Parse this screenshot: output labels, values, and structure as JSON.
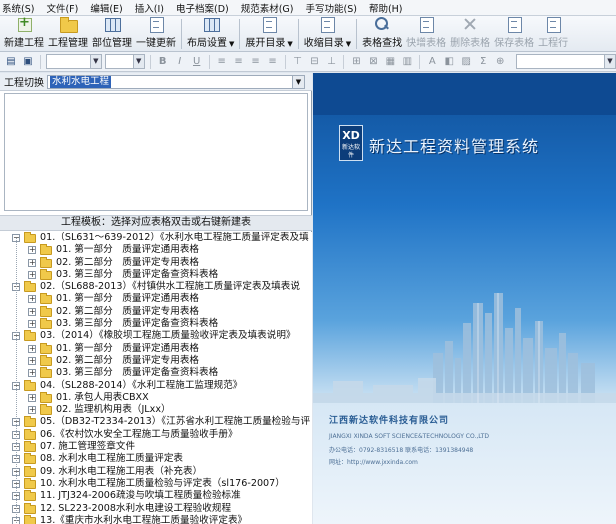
{
  "menu": [
    "系统(S)",
    "文件(F)",
    "编辑(E)",
    "插入(I)",
    "电子档案(D)",
    "规范素材(G)",
    "手写功能(S)",
    "帮助(H)"
  ],
  "toolbar": {
    "new_project": "新建工程",
    "project_manage": "工程管理",
    "dept_manage": "部位管理",
    "one_key_update": "一键更新",
    "layout_settings": "布局设置",
    "expand_dir": "展开目录",
    "collapse_dir": "收缩目录",
    "table_search": "表格查找",
    "quick_add": "快增表格",
    "delete_table": "删除表格",
    "save_table": "保存表格",
    "project_line": "工程行"
  },
  "project_switch": {
    "label": "工程切换",
    "value": "水利水电工程"
  },
  "template_header": "工程模板：选择对应表格双击或右键新建表",
  "tree": [
    {
      "level": 0,
      "text": "01.（SL631～639-2012）《水利水电工程施工质量评定表及填"
    },
    {
      "level": 1,
      "text": "01. 第一部分　质量评定通用表格"
    },
    {
      "level": 1,
      "text": "02. 第二部分　质量评定专用表格"
    },
    {
      "level": 1,
      "text": "03. 第三部分　质量评定备查资料表格"
    },
    {
      "level": 0,
      "text": "02.（SL688-2013）《村镇供水工程施工质量评定表及填表说"
    },
    {
      "level": 1,
      "text": "01. 第一部分　质量评定通用表格"
    },
    {
      "level": 1,
      "text": "02. 第二部分　质量评定专用表格"
    },
    {
      "level": 1,
      "text": "03. 第三部分　质量评定备查资料表格"
    },
    {
      "level": 0,
      "text": "03.（2014）《橡胶坝工程施工质量验收评定表及填表说明》"
    },
    {
      "level": 1,
      "text": "01. 第一部分　质量评定通用表格"
    },
    {
      "level": 1,
      "text": "02. 第二部分　质量评定专用表格"
    },
    {
      "level": 1,
      "text": "03. 第三部分　质量评定备查资料表格"
    },
    {
      "level": 0,
      "text": "04.（SL288-2014）《水利工程施工监理规范》"
    },
    {
      "level": 1,
      "text": "01. 承包人用表CBXX"
    },
    {
      "level": 1,
      "text": "02. 监理机构用表（JLxx）"
    },
    {
      "level": 0,
      "text": "05.（DB32-T2334-2013）《江苏省水利工程施工质量检验与评"
    },
    {
      "level": 0,
      "text": "06.《农村饮水安全工程施工与质量验收手册》"
    },
    {
      "level": 0,
      "text": "07. 施工管理签章文件"
    },
    {
      "level": 0,
      "text": "08. 水利水电工程施工质量评定表"
    },
    {
      "level": 0,
      "text": "09. 水利水电工程施工用表（补充表）"
    },
    {
      "level": 0,
      "text": "10. 水利水电工程施工质量检验与评定表（sl176-2007）"
    },
    {
      "level": 0,
      "text": "11. JTJ324-2006疏浚与吹填工程质量检验标准"
    },
    {
      "level": 0,
      "text": "12. SL223-2008水利水电建设工程验收规程"
    },
    {
      "level": 0,
      "text": "13.《重庆市水利水电工程施工质量验收评定表》"
    },
    {
      "level": 0,
      "text": "14.（DG-TJ08-90-2014）《上海市水利工程施工质量检验与评"
    }
  ],
  "splash": {
    "logo_text": "XD",
    "logo_sub": "新达软件",
    "title": "新达工程资料管理系统",
    "company": "江西新达软件科技有限公司",
    "line1": "JIANGXI XINDA SOFT SCIENCE&TECHNOLOGY CO.,LTD",
    "line2": "办公电话：0792-8316518  联系电话：1391384948",
    "line3": "网址：http://www.jxxinda.com"
  },
  "colors": {
    "selection": "#2e63b8",
    "splash_blue": "#1d63b0"
  }
}
